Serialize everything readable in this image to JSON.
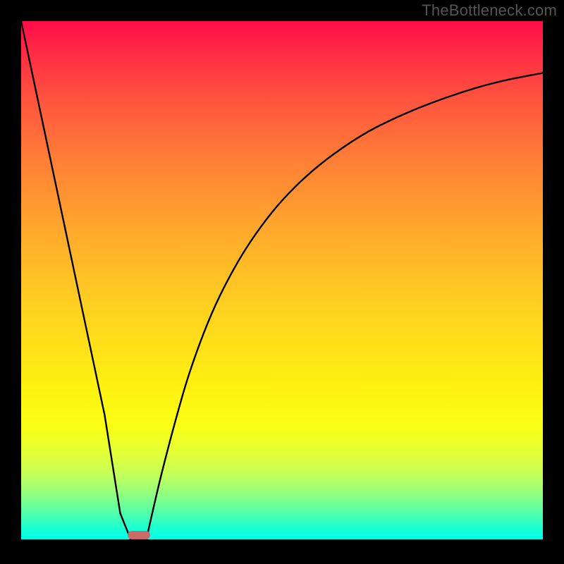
{
  "watermark": "TheBottleneck.com",
  "colors": {
    "frame": "#000000",
    "curve": "#000000",
    "marker": "#cb6a6b",
    "watermark": "#555555"
  },
  "chart_data": {
    "type": "line",
    "title": "",
    "xlabel": "",
    "ylabel": "",
    "xlim": [
      0,
      100
    ],
    "ylim": [
      0,
      100
    ],
    "grid": false,
    "legend": false,
    "series": [
      {
        "name": "left-branch",
        "x": [
          0,
          2,
          4,
          6,
          8,
          10,
          12,
          14,
          16,
          17.5,
          19,
          21
        ],
        "y": [
          100,
          90.5,
          81,
          71.5,
          62,
          52.5,
          43,
          33.5,
          24,
          14.5,
          5,
          0
        ]
      },
      {
        "name": "right-branch",
        "x": [
          24,
          26,
          28,
          30,
          32,
          35,
          38,
          42,
          46,
          50,
          55,
          60,
          66,
          72,
          78,
          85,
          92,
          100
        ],
        "y": [
          0,
          9,
          17,
          24.5,
          31.5,
          40,
          47,
          54.5,
          60.5,
          65.5,
          70.5,
          74.5,
          78.5,
          81.5,
          84,
          86.5,
          88.5,
          90
        ]
      }
    ],
    "marker": {
      "x": 22.5,
      "y": 0.8,
      "shape": "rounded-bar"
    },
    "gradient_stops": [
      {
        "pct": 0,
        "color": "#ff0b47"
      },
      {
        "pct": 14,
        "color": "#ff4f3f"
      },
      {
        "pct": 40,
        "color": "#ffa82d"
      },
      {
        "pct": 70,
        "color": "#fff011"
      },
      {
        "pct": 87,
        "color": "#c8ff55"
      },
      {
        "pct": 100,
        "color": "#01ffe8"
      }
    ]
  }
}
